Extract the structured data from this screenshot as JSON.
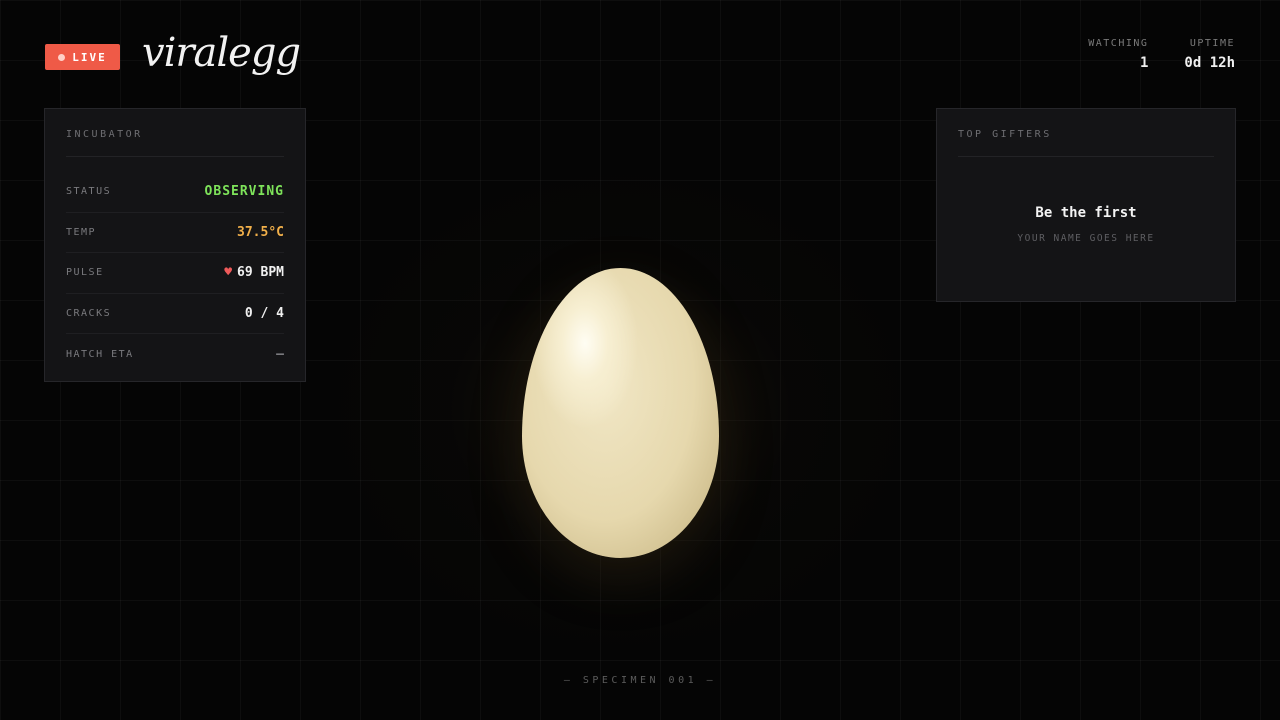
{
  "header": {
    "live_label": "LIVE",
    "logo_text": "viralegg",
    "stats": [
      {
        "label": "WATCHING",
        "value": "1"
      },
      {
        "label": "UPTIME",
        "value": "0d 12h"
      }
    ]
  },
  "incubator": {
    "title": "INCUBATOR",
    "rows": [
      {
        "label": "STATUS",
        "value": "OBSERVING",
        "color": "#7ee35a"
      },
      {
        "label": "TEMP",
        "value": "37.5°C",
        "color": "#f2b04a"
      },
      {
        "label": "PULSE",
        "value": "69 BPM",
        "icon": "heart-icon",
        "color": "#f0f0f0"
      },
      {
        "label": "CRACKS",
        "value": "0 / 4",
        "color": "#f0f0f0"
      },
      {
        "label": "HATCH ETA",
        "value": "—",
        "color": "#7a7a7e"
      }
    ]
  },
  "gifters": {
    "title": "TOP GIFTERS",
    "empty_title": "Be the first",
    "empty_sub": "YOUR NAME GOES HERE"
  },
  "footer": {
    "specimen_label": "— SPECIMEN 001 —"
  },
  "colors": {
    "live": "#ef5a47",
    "status_green": "#7ee35a",
    "temp_orange": "#f2b04a",
    "egg": "#ede2bd"
  }
}
